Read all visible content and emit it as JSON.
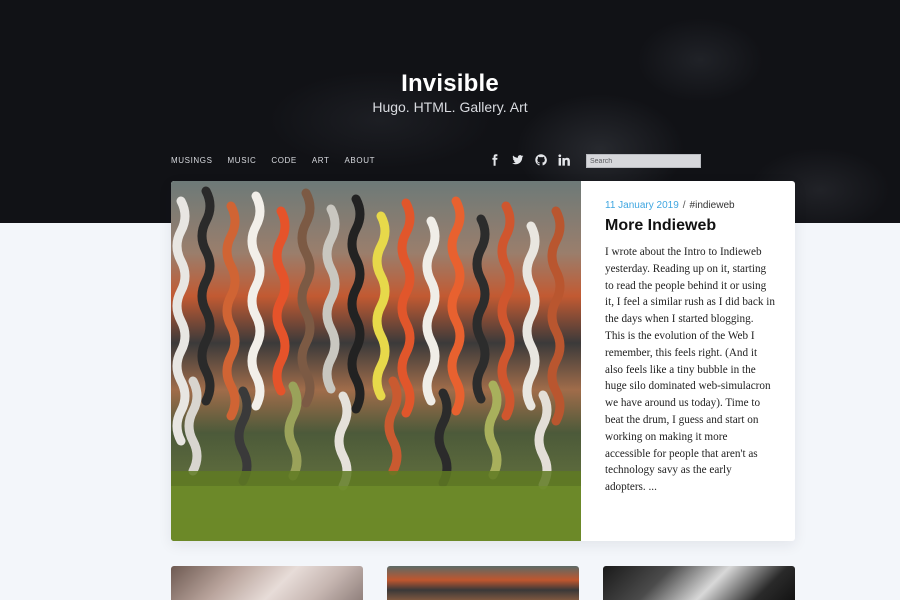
{
  "site": {
    "title": "Invisible",
    "tagline": "Hugo. HTML. Gallery. Art"
  },
  "nav": {
    "items": [
      {
        "label": "MUSINGS"
      },
      {
        "label": "MUSIC"
      },
      {
        "label": "CODE"
      },
      {
        "label": "ART"
      },
      {
        "label": "ABOUT"
      }
    ]
  },
  "social": {
    "icons": [
      "facebook-icon",
      "twitter-icon",
      "github-icon",
      "linkedin-icon"
    ]
  },
  "search": {
    "placeholder": "Search"
  },
  "featured": {
    "date": "11 January 2019",
    "separator": "/",
    "tag": "#indieweb",
    "title": "More Indieweb",
    "excerpt": "I wrote about the Intro to Indieweb yesterday. Reading up on it, starting to read the people behind it or using it, I feel a similar rush as I did back in the days when I started blogging. This is the evolution of the Web I remember, this feels right. (And it also feels like a tiny bubble in the huge silo dominated web-simulacron we have around us today). Time to beat the drum, I guess and start on working on making it more accessible for people that aren't as technology savy as the early adopters. ..."
  },
  "colors": {
    "accent": "#3fa6e0",
    "header_bg": "#111216",
    "page_bg": "#f3f6fa"
  }
}
